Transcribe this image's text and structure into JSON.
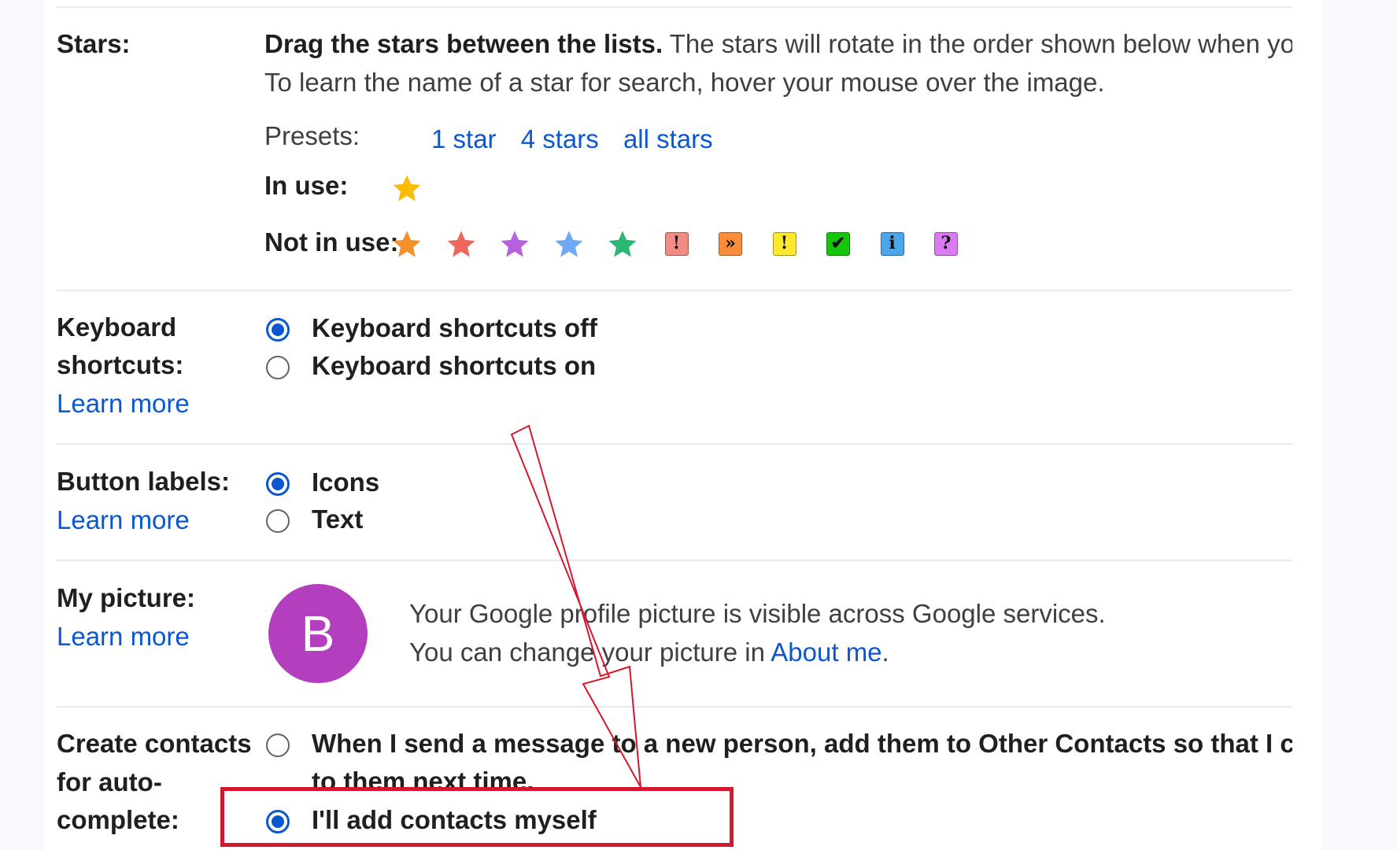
{
  "stars": {
    "label": "Stars:",
    "instructions_bold": "Drag the stars between the lists.",
    "instructions_rest": " The stars will rotate in the order shown below when you click successively.",
    "hover_hint": "To learn the name of a star for search, hover your mouse over the image.",
    "presets_label": "Presets:",
    "presets": [
      "1 star",
      "4 stars",
      "all stars"
    ],
    "in_use_label": "In use:",
    "in_use": [
      {
        "icon": "yellow-star-icon",
        "color": "#fbbc04"
      }
    ],
    "not_in_use_label": "Not in use:",
    "not_in_use_stars": [
      {
        "icon": "orange-star-icon",
        "color": "#f4902c"
      },
      {
        "icon": "red-star-icon",
        "color": "#ee675c"
      },
      {
        "icon": "purple-star-icon",
        "color": "#b661dd"
      },
      {
        "icon": "blue-star-icon",
        "color": "#6fa8f5"
      },
      {
        "icon": "green-star-icon",
        "color": "#2bb673"
      }
    ],
    "not_in_use_badges": [
      {
        "icon": "red-bang-icon",
        "glyph": "!",
        "color": "#f28b82"
      },
      {
        "icon": "orange-guillemet-icon",
        "glyph": "»",
        "color": "#fb8c3c"
      },
      {
        "icon": "yellow-bang-icon",
        "glyph": "!",
        "color": "#fde72f"
      },
      {
        "icon": "green-check-icon",
        "glyph": "✔",
        "color": "#16c60c"
      },
      {
        "icon": "blue-info-icon",
        "glyph": "i",
        "color": "#4ca6ea"
      },
      {
        "icon": "purple-question-icon",
        "glyph": "?",
        "color": "#d97cf2"
      }
    ]
  },
  "keyboard": {
    "label_line1": "Keyboard",
    "label_line2": "shortcuts:",
    "learn_more": "Learn more",
    "option_off": "Keyboard shortcuts off",
    "option_on": "Keyboard shortcuts on",
    "selected": "off"
  },
  "button_labels": {
    "label": "Button labels:",
    "learn_more": "Learn more",
    "option_icons": "Icons",
    "option_text": "Text",
    "selected": "icons"
  },
  "picture": {
    "label": "My picture:",
    "learn_more": "Learn more",
    "avatar_letter": "B",
    "avatar_color": "#b33fbf",
    "line1": "Your Google profile picture is visible across Google services.",
    "line2_prefix": "You can change your picture in ",
    "link": "About me",
    "line2_suffix": "."
  },
  "contacts": {
    "label_line1": "Create contacts",
    "label_line2": "for auto-",
    "label_line3": "complete:",
    "option_auto_line1": "When I send a message to a new person, add them to Other Contacts so that I can auto-complete",
    "option_auto_line2": "to them next time.",
    "option_manual": "I'll add contacts myself",
    "selected": "manual"
  },
  "colors": {
    "accent": "#0b57d0",
    "annotation": "#d3172e"
  }
}
